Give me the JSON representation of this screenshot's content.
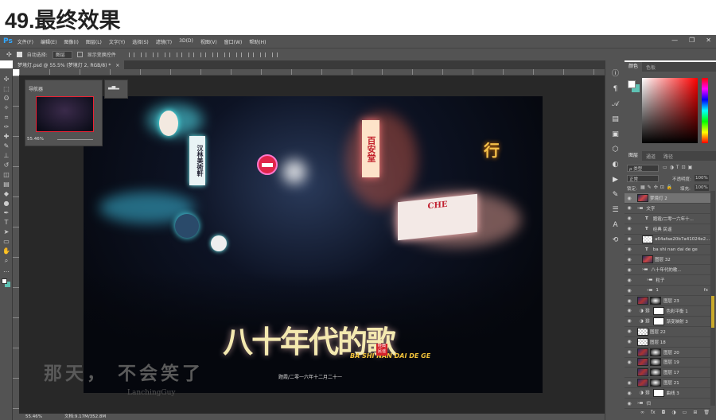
{
  "page_title": "49.最终效果",
  "app": {
    "logo": "Ps",
    "menu": [
      "文件(F)",
      "编辑(E)",
      "图像(I)",
      "图层(L)",
      "文字(Y)",
      "选择(S)",
      "滤镜(T)",
      "3D(D)",
      "视图(V)",
      "窗口(W)",
      "帮助(H)"
    ],
    "window_controls": [
      "—",
      "❐",
      "✕"
    ]
  },
  "options": {
    "move_icon": "✣",
    "auto_select_label": "自动选择:",
    "auto_select_value": "图层",
    "transform_label": "显示变换控件"
  },
  "document_tab": {
    "label": "梦境灯.psd @ 55.5% (梦境灯 2, RGB/8) *",
    "close": "×"
  },
  "navigator": {
    "title": "导航器",
    "zoom": "55.46%"
  },
  "status": {
    "zoom": "55.46%",
    "doc_size": "文档:9.17M/352.8M"
  },
  "artwork": {
    "title": "八十年代的歌",
    "pinyin": "BA SHI NAN DAI DE GE",
    "seal": "经典民谣",
    "subtitle": "题霞/二零一六年十二月二十一",
    "signs": [
      "百安堂",
      "汉林美術軒",
      "CHE",
      "行"
    ],
    "watermark_text": "那天， 不会笑了",
    "watermark_author": "LanchingGuy"
  },
  "color_panel": {
    "tabs": [
      "颜色",
      "色板"
    ],
    "fg": "#ffffff",
    "bg": "#5ec2b4"
  },
  "layers_panel": {
    "tabs": [
      "图层",
      "通道",
      "路径"
    ],
    "filter": "ρ 类型",
    "blend_mode": "正常",
    "opacity_label": "不透明度:",
    "opacity": "100%",
    "lock_label": "锁定:",
    "fill_label": "填充:",
    "fill": "100%",
    "layers": [
      {
        "name": "梦境灯 2",
        "kind": "image",
        "indent": 0,
        "selected": true
      },
      {
        "name": "文字",
        "kind": "group",
        "indent": 0
      },
      {
        "name": "题霞/二零一六年十...",
        "kind": "text",
        "indent": 1
      },
      {
        "name": "经典 民谣",
        "kind": "text",
        "indent": 1
      },
      {
        "name": "a64afae20b7a41024e2...",
        "kind": "smart",
        "indent": 1
      },
      {
        "name": "ba shi nan dai de ge",
        "kind": "text",
        "indent": 1
      },
      {
        "name": "图层 32",
        "kind": "image",
        "indent": 1
      },
      {
        "name": "八十年代的歌...",
        "kind": "group",
        "indent": 1
      },
      {
        "name": "粒子",
        "kind": "group",
        "indent": 2
      },
      {
        "name": "1",
        "kind": "group",
        "indent": 2,
        "fx": "fx"
      },
      {
        "name": "图层 23",
        "kind": "masked",
        "indent": 0
      },
      {
        "name": "色彩平衡 1",
        "kind": "adjust",
        "indent": 0
      },
      {
        "name": "渐变映射 3",
        "kind": "adjust",
        "indent": 0
      },
      {
        "name": "图层 22",
        "kind": "transparent",
        "indent": 0
      },
      {
        "name": "图层 18",
        "kind": "transparent",
        "indent": 0
      },
      {
        "name": "图层 20",
        "kind": "masked",
        "indent": 0
      },
      {
        "name": "图层 19",
        "kind": "masked",
        "indent": 0
      },
      {
        "name": "图层 17",
        "kind": "masked",
        "indent": 0,
        "hidden": true
      },
      {
        "name": "图层 21",
        "kind": "masked",
        "indent": 0
      },
      {
        "name": "曲线 3",
        "kind": "adjust",
        "indent": 0
      },
      {
        "name": "归",
        "kind": "group",
        "indent": 0
      }
    ],
    "bottom_icons": [
      "∞",
      "fx",
      "◘",
      "◑",
      "▭",
      "⊞",
      "🗑"
    ]
  }
}
